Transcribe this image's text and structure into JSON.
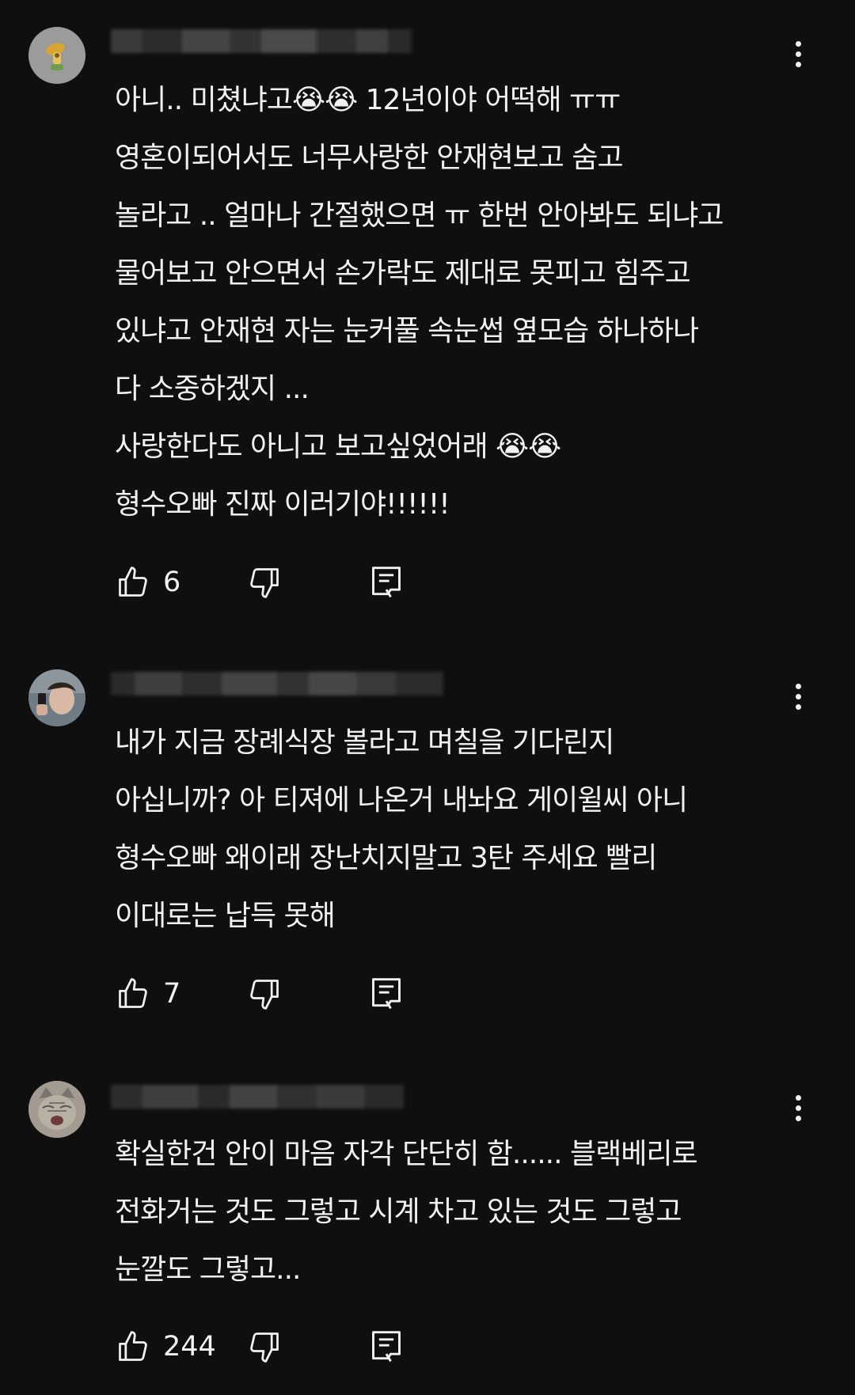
{
  "comments": [
    {
      "avatar": "avatar-character-icon",
      "body": "아니.. 미쳤냐고😭😭 12년이야  어떡해 ㅠㅠ\n영혼이되어서도 너무사랑한 안재현보고 숨고\n놀라고 .. 얼마나 간절했으면 ㅠ 한번 안아봐도 되냐고\n물어보고 안으면서 손가락도 제대로 못피고 힘주고\n있냐고 안재현 자는 눈커풀 속눈썹  옆모습 하나하나\n다 소중하겠지 ...\n사랑한다도 아니고 보고싶었어래 😭😭\n형수오빠 진짜 이러기야!!!!!!",
      "likes": "6"
    },
    {
      "avatar": "avatar-selfie-photo",
      "body": "내가 지금 장례식장 볼라고 며칠을 기다린지\n아십니까? 아 티져에 나온거 내놔요 게이윌씨 아니\n형수오빠 왜이래 장난치지말고 3탄 주세요 빨리\n이대로는 납득 못해",
      "likes": "7"
    },
    {
      "avatar": "avatar-cat-photo",
      "body": "확실한건 안이 마음 자각 단단히 함...... 블랙베리로\n전화거는 것도 그렇고 시계 차고 있는 것도 그렇고\n눈깔도 그렇고...",
      "likes": "244"
    }
  ],
  "icons": {
    "like": "thumbs-up-icon",
    "dislike": "thumbs-down-icon",
    "reply": "reply-comment-icon",
    "menu": "more-vert-icon"
  },
  "colors": {
    "background": "#0f0f0f",
    "text": "#f1f1f1"
  }
}
